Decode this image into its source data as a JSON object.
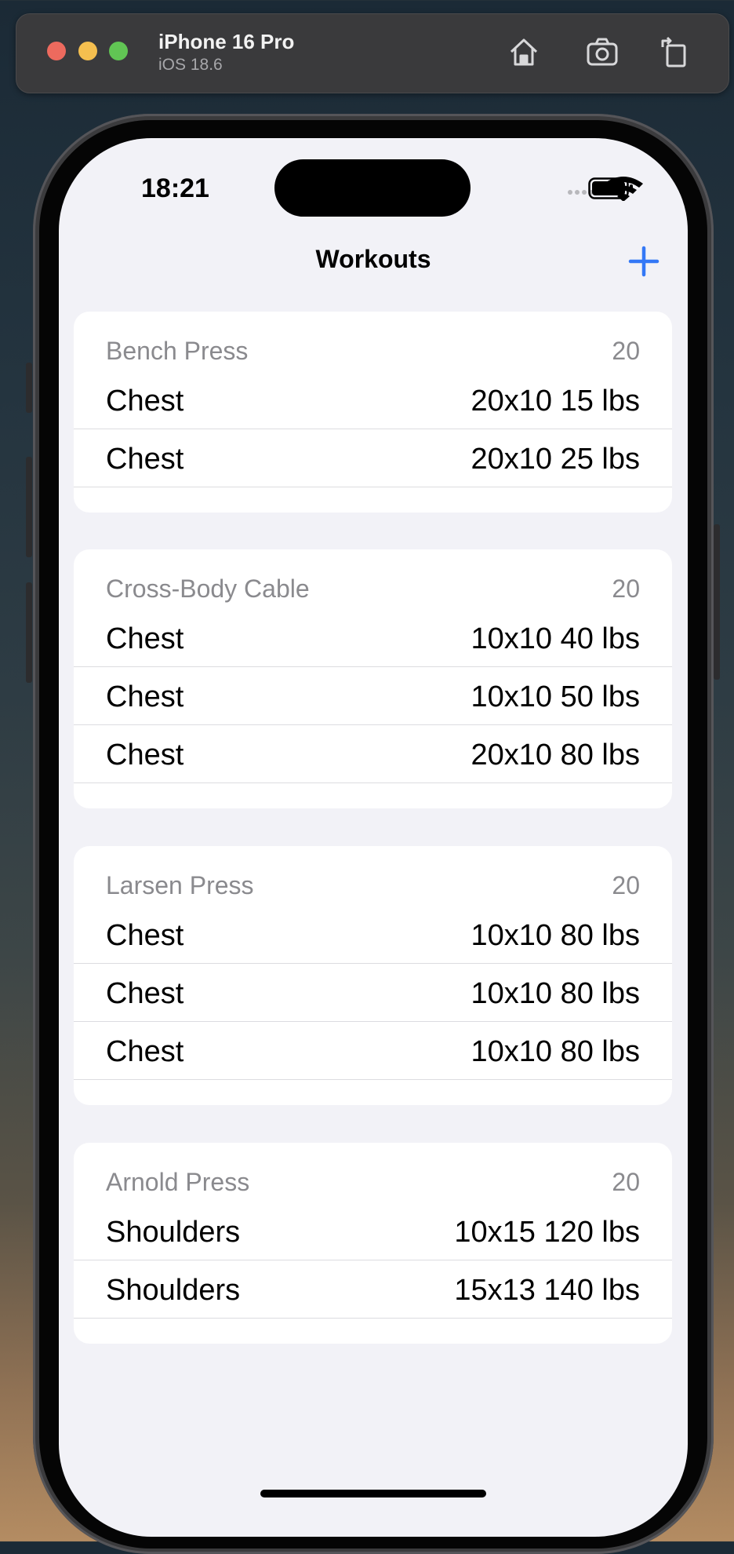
{
  "simulator": {
    "device_name": "iPhone 16 Pro",
    "os_version": "iOS 18.6",
    "icons": [
      "home-icon",
      "screenshot-icon",
      "rotate-icon"
    ]
  },
  "status_bar": {
    "time": "18:21",
    "icons": [
      "signal-icon",
      "wifi-icon",
      "battery-icon"
    ]
  },
  "nav": {
    "title": "Workouts",
    "add_icon": "plus-icon"
  },
  "workouts": [
    {
      "name": "Bench Press",
      "count": "20",
      "sets": [
        {
          "muscle": "Chest",
          "detail": "20x10 15 lbs"
        },
        {
          "muscle": "Chest",
          "detail": "20x10 25 lbs"
        }
      ]
    },
    {
      "name": "Cross-Body Cable",
      "count": "20",
      "sets": [
        {
          "muscle": "Chest",
          "detail": "10x10 40 lbs"
        },
        {
          "muscle": "Chest",
          "detail": "10x10 50 lbs"
        },
        {
          "muscle": "Chest",
          "detail": "20x10 80 lbs"
        }
      ]
    },
    {
      "name": "Larsen Press",
      "count": "20",
      "sets": [
        {
          "muscle": "Chest",
          "detail": "10x10 80 lbs"
        },
        {
          "muscle": "Chest",
          "detail": "10x10 80 lbs"
        },
        {
          "muscle": "Chest",
          "detail": "10x10 80 lbs"
        }
      ]
    },
    {
      "name": "Arnold Press",
      "count": "20",
      "sets": [
        {
          "muscle": "Shoulders",
          "detail": "10x15 120 lbs"
        },
        {
          "muscle": "Shoulders",
          "detail": "15x13 140 lbs"
        }
      ]
    }
  ],
  "colors": {
    "accent": "#3478f6",
    "background": "#f2f2f7",
    "secondary_text": "#8a8a8e"
  }
}
